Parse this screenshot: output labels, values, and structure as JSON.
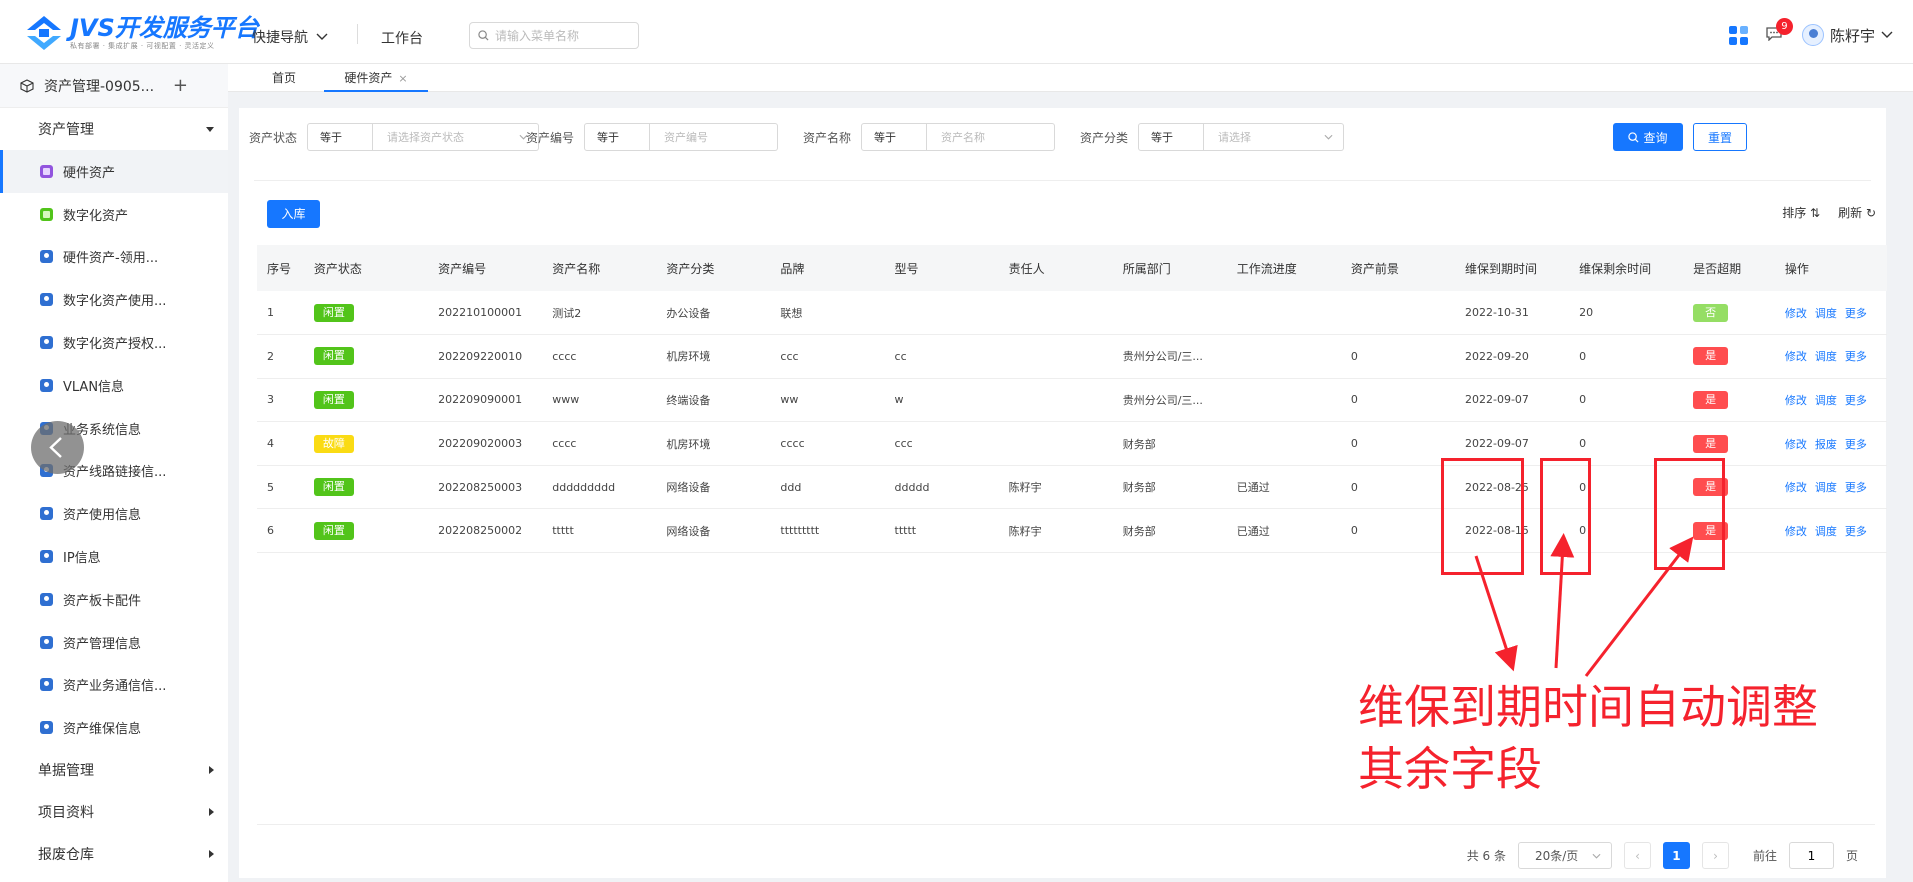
{
  "topbar": {
    "logo_title": "JVS开发服务平台",
    "logo_sub": "私有部署 · 集成扩展 · 可视配置 · 灵活定义",
    "quick_nav": "快捷导航",
    "workbench": "工作台",
    "search_placeholder": "请输入菜单名称",
    "badge_count": "9",
    "username": "陈籽宇"
  },
  "sidebar": {
    "app_name": "资产管理-0905...",
    "group_open": "资产管理",
    "items": [
      {
        "label": "硬件资产",
        "icon": "purple"
      },
      {
        "label": "数字化资产",
        "icon": "green"
      },
      {
        "label": "硬件资产-领用...",
        "icon": "blue"
      },
      {
        "label": "数字化资产使用...",
        "icon": "blue"
      },
      {
        "label": "数字化资产授权...",
        "icon": "blue"
      },
      {
        "label": "VLAN信息",
        "icon": "blue"
      },
      {
        "label": "业务系统信息",
        "icon": "blue"
      },
      {
        "label": "资产线路链接信...",
        "icon": "blue"
      },
      {
        "label": "资产使用信息",
        "icon": "blue"
      },
      {
        "label": "IP信息",
        "icon": "blue"
      },
      {
        "label": "资产板卡配件",
        "icon": "blue"
      },
      {
        "label": "资产管理信息",
        "icon": "blue"
      },
      {
        "label": "资产业务通信信...",
        "icon": "blue"
      },
      {
        "label": "资产维保信息",
        "icon": "blue"
      }
    ],
    "groups_closed": [
      "单据管理",
      "项目资料",
      "报废仓库"
    ]
  },
  "tabs": {
    "home": "首页",
    "active": "硬件资产",
    "close": "×"
  },
  "filters": [
    {
      "label": "资产状态",
      "op": "等于",
      "placeholder": "请选择资产状态",
      "dropdown": true
    },
    {
      "label": "资产编号",
      "op": "等于",
      "placeholder": "资产编号",
      "dropdown": false
    },
    {
      "label": "资产名称",
      "op": "等于",
      "placeholder": "资产名称",
      "dropdown": false
    },
    {
      "label": "资产分类",
      "op": "等于",
      "placeholder": "请选择",
      "dropdown": true
    }
  ],
  "buttons": {
    "query": "查询",
    "reset": "重置",
    "stock_in": "入库",
    "sort": "排序",
    "refresh": "刷新"
  },
  "table": {
    "headers": [
      "序号",
      "资产状态",
      "资产编号",
      "资产名称",
      "资产分类",
      "品牌",
      "型号",
      "责任人",
      "所属部门",
      "工作流进度",
      "资产前景",
      "维保到期时间",
      "维保剩余时间",
      "是否超期",
      "操作"
    ],
    "rows": [
      {
        "no": "1",
        "status": "闲置",
        "status_color": "green",
        "code": "202210100001",
        "name": "测试2",
        "category": "办公设备",
        "brand": "联想",
        "model": "",
        "owner": "",
        "dept": "",
        "flow": "",
        "prospect": "",
        "expire": "2022-10-31",
        "remain": "20",
        "overdue": "否",
        "overdue_color": "lightgreen",
        "actions": [
          "修改",
          "调度",
          "更多"
        ]
      },
      {
        "no": "2",
        "status": "闲置",
        "status_color": "green",
        "code": "202209220010",
        "name": "cccc",
        "category": "机房环境",
        "brand": "ccc",
        "model": "cc",
        "owner": "",
        "dept": "贵州分公司/三...",
        "flow": "",
        "prospect": "0",
        "expire": "2022-09-20",
        "remain": "0",
        "overdue": "是",
        "overdue_color": "red",
        "actions": [
          "修改",
          "调度",
          "更多"
        ]
      },
      {
        "no": "3",
        "status": "闲置",
        "status_color": "green",
        "code": "202209090001",
        "name": "www",
        "category": "终端设备",
        "brand": "ww",
        "model": "w",
        "owner": "",
        "dept": "贵州分公司/三...",
        "flow": "",
        "prospect": "0",
        "expire": "2022-09-07",
        "remain": "0",
        "overdue": "是",
        "overdue_color": "red",
        "actions": [
          "修改",
          "调度",
          "更多"
        ]
      },
      {
        "no": "4",
        "status": "故障",
        "status_color": "yellow",
        "code": "202209020003",
        "name": "cccc",
        "category": "机房环境",
        "brand": "cccc",
        "model": "ccc",
        "owner": "",
        "dept": "财务部",
        "flow": "",
        "prospect": "0",
        "expire": "2022-09-07",
        "remain": "0",
        "overdue": "是",
        "overdue_color": "red",
        "actions": [
          "修改",
          "报废",
          "更多"
        ]
      },
      {
        "no": "5",
        "status": "闲置",
        "status_color": "green",
        "code": "202208250003",
        "name": "ddddddddd",
        "category": "网络设备",
        "brand": "ddd",
        "model": "ddddd",
        "owner": "陈籽宇",
        "dept": "财务部",
        "flow": "已通过",
        "prospect": "0",
        "expire": "2022-08-25",
        "remain": "0",
        "overdue": "是",
        "overdue_color": "red",
        "actions": [
          "修改",
          "调度",
          "更多"
        ]
      },
      {
        "no": "6",
        "status": "闲置",
        "status_color": "green",
        "code": "202208250002",
        "name": "ttttt",
        "category": "网络设备",
        "brand": "ttttttttt",
        "model": "ttttt",
        "owner": "陈籽宇",
        "dept": "财务部",
        "flow": "已通过",
        "prospect": "0",
        "expire": "2022-08-15",
        "remain": "0",
        "overdue": "是",
        "overdue_color": "red",
        "actions": [
          "修改",
          "调度",
          "更多"
        ]
      }
    ]
  },
  "pagination": {
    "total": "共 6 条",
    "page_size": "20条/页",
    "current": "1",
    "goto_label": "前往",
    "goto_value": "1",
    "page_unit": "页"
  },
  "annotation": {
    "line1": "维保到期时间自动调整",
    "line2": "其余字段",
    "color": "#f5222d"
  }
}
